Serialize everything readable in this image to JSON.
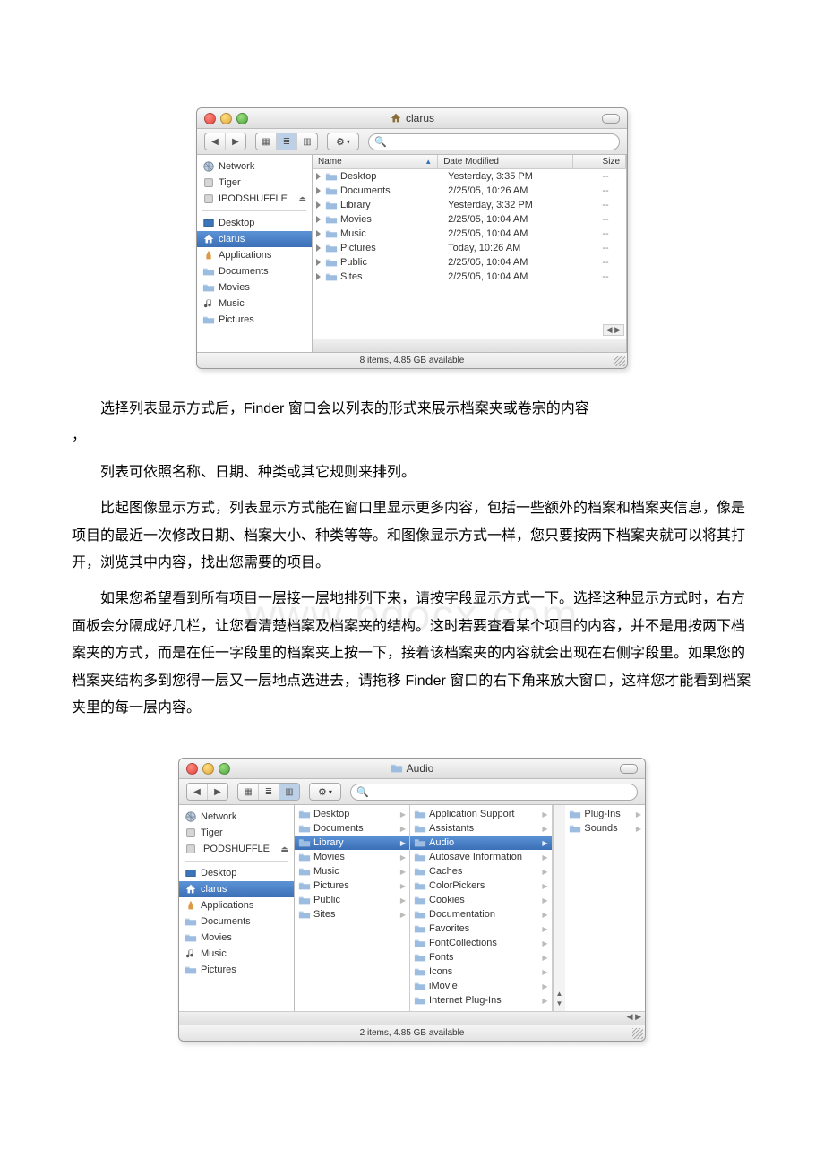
{
  "watermark": "www.bdocx.com",
  "finder1": {
    "title": "clarus",
    "status": "8 items, 4.85 GB available",
    "headers": {
      "name": "Name",
      "date": "Date Modified",
      "size": "Size"
    },
    "sidebar": [
      {
        "label": "Network",
        "icon": "globe"
      },
      {
        "label": "Tiger",
        "icon": "disk"
      },
      {
        "label": "IPODSHUFFLE",
        "icon": "disk",
        "eject": true
      },
      {
        "divider": true
      },
      {
        "label": "Desktop",
        "icon": "desktop"
      },
      {
        "label": "clarus",
        "icon": "home",
        "selected": true
      },
      {
        "label": "Applications",
        "icon": "app"
      },
      {
        "label": "Documents",
        "icon": "folder"
      },
      {
        "label": "Movies",
        "icon": "folder"
      },
      {
        "label": "Music",
        "icon": "music"
      },
      {
        "label": "Pictures",
        "icon": "folder"
      }
    ],
    "rows": [
      {
        "name": "Desktop",
        "date": "Yesterday, 3:35 PM",
        "size": "--"
      },
      {
        "name": "Documents",
        "date": "2/25/05, 10:26 AM",
        "size": "--"
      },
      {
        "name": "Library",
        "date": "Yesterday, 3:32 PM",
        "size": "--"
      },
      {
        "name": "Movies",
        "date": "2/25/05, 10:04 AM",
        "size": "--"
      },
      {
        "name": "Music",
        "date": "2/25/05, 10:04 AM",
        "size": "--"
      },
      {
        "name": "Pictures",
        "date": "Today, 10:26 AM",
        "size": "--"
      },
      {
        "name": "Public",
        "date": "2/25/05, 10:04 AM",
        "size": "--"
      },
      {
        "name": "Sites",
        "date": "2/25/05, 10:04 AM",
        "size": "--"
      }
    ]
  },
  "paragraphs": {
    "p1_lead": "　　选择列表显示方式后，Finder 窗口会以列表的形式来展示档案夹或卷宗的内容",
    "p1_tail": "，",
    "p2": "　　列表可依照名称、日期、种类或其它规则来排列。",
    "p3": "　　比起图像显示方式，列表显示方式能在窗口里显示更多内容，包括一些额外的档案和档案夹信息，像是项目的最近一次修改日期、档案大小、种类等等。和图像显示方式一样，您只要按两下档案夹就可以将其打开，浏览其中内容，找出您需要的项目。",
    "p4": "　　如果您希望看到所有项目一层接一层地排列下来，请按字段显示方式一下。选择这种显示方式时，右方面板会分隔成好几栏，让您看清楚档案及档案夹的结构。这时若要查看某个项目的内容，并不是用按两下档案夹的方式，而是在任一字段里的档案夹上按一下，接着该档案夹的内容就会出现在右侧字段里。如果您的档案夹结构多到您得一层又一层地点选进去，请拖移 Finder 窗口的右下角来放大窗口，这样您才能看到档案夹里的每一层内容。"
  },
  "finder2": {
    "title": "Audio",
    "status": "2 items, 4.85 GB available",
    "sidebar": [
      {
        "label": "Network",
        "icon": "globe"
      },
      {
        "label": "Tiger",
        "icon": "disk"
      },
      {
        "label": "IPODSHUFFLE",
        "icon": "disk",
        "eject": true
      },
      {
        "divider": true
      },
      {
        "label": "Desktop",
        "icon": "desktop"
      },
      {
        "label": "clarus",
        "icon": "home",
        "selected": true
      },
      {
        "label": "Applications",
        "icon": "app"
      },
      {
        "label": "Documents",
        "icon": "folder"
      },
      {
        "label": "Movies",
        "icon": "folder"
      },
      {
        "label": "Music",
        "icon": "music"
      },
      {
        "label": "Pictures",
        "icon": "folder"
      }
    ],
    "col1": [
      {
        "label": "Desktop"
      },
      {
        "label": "Documents"
      },
      {
        "label": "Library",
        "selected": true
      },
      {
        "label": "Movies"
      },
      {
        "label": "Music"
      },
      {
        "label": "Pictures"
      },
      {
        "label": "Public"
      },
      {
        "label": "Sites"
      }
    ],
    "col2": [
      {
        "label": "Application Support"
      },
      {
        "label": "Assistants"
      },
      {
        "label": "Audio",
        "selected": true
      },
      {
        "label": "Autosave Information"
      },
      {
        "label": "Caches"
      },
      {
        "label": "ColorPickers"
      },
      {
        "label": "Cookies"
      },
      {
        "label": "Documentation"
      },
      {
        "label": "Favorites"
      },
      {
        "label": "FontCollections"
      },
      {
        "label": "Fonts"
      },
      {
        "label": "Icons"
      },
      {
        "label": "iMovie"
      },
      {
        "label": "Internet Plug-Ins"
      }
    ],
    "col3": [
      {
        "label": "Plug-Ins"
      },
      {
        "label": "Sounds"
      }
    ]
  }
}
